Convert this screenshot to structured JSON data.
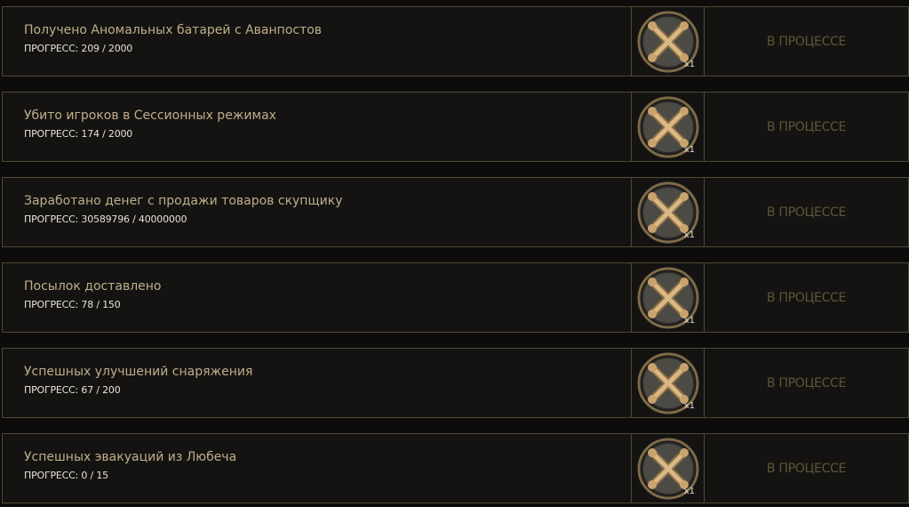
{
  "status_label": "В ПРОЦЕССЕ",
  "colors": {
    "title": "#bfae8a",
    "progress": "#e6e2d6",
    "status": "#5f5538",
    "border": "#4e4a38",
    "medal_bronze": "#b08c5a"
  },
  "reward_icon": "crossed-bones-medal-icon",
  "tasks": [
    {
      "title": "Получено Аномальных батарей с Аванпостов",
      "progress": "ПРОГРЕСС: 209 / 2000",
      "reward_qty": "x1"
    },
    {
      "title": "Убито игроков в Сессионных режимах",
      "progress": "ПРОГРЕСС: 174 / 2000",
      "reward_qty": "x1"
    },
    {
      "title": "Заработано денег с продажи товаров скупщику",
      "progress": "ПРОГРЕСС: 30589796 / 40000000",
      "reward_qty": "x1"
    },
    {
      "title": "Посылок доставлено",
      "progress": "ПРОГРЕСС: 78 / 150",
      "reward_qty": "x1"
    },
    {
      "title": "Успешных улучшений снаряжения",
      "progress": "ПРОГРЕСС: 67 / 200",
      "reward_qty": "x1"
    },
    {
      "title": "Успешных эвакуаций из Любеча",
      "progress": "ПРОГРЕСС: 0 / 15",
      "reward_qty": "x1"
    }
  ]
}
